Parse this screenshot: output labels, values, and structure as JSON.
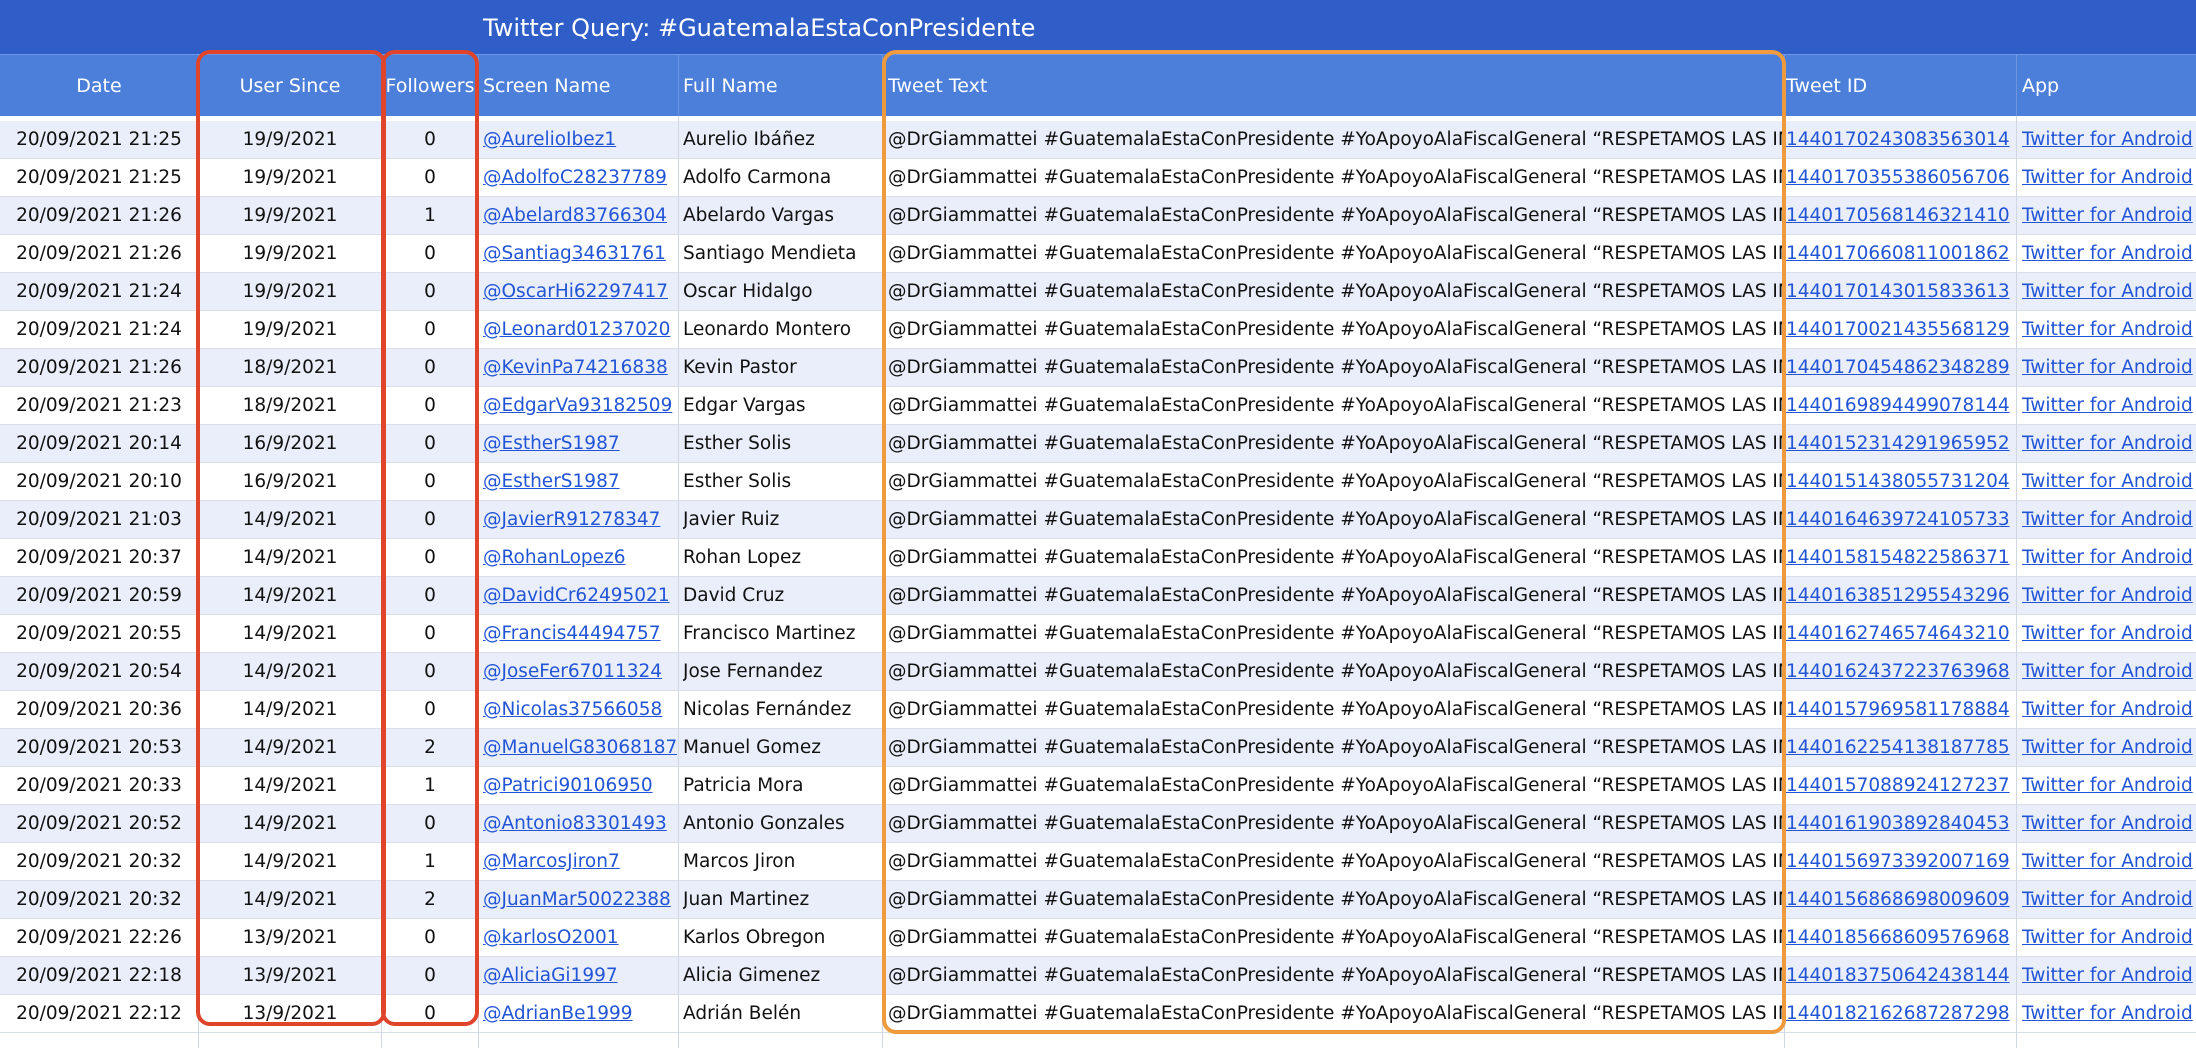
{
  "title": "Twitter Query: #GuatemalaEstaConPresidente",
  "columns": {
    "date": "Date",
    "user_since": "User Since",
    "followers": "Followers",
    "screen_name": "Screen Name",
    "full_name": "Full Name",
    "tweet_text": "Tweet Text",
    "tweet_id": "Tweet ID",
    "app": "App"
  },
  "highlight_colors": {
    "red": "#e0442b",
    "orange": "#ef9a3c"
  },
  "rows": [
    {
      "date": "20/09/2021 21:25",
      "user_since": "19/9/2021",
      "followers": "0",
      "screen_name": "@AurelioIbez1",
      "full_name": "Aurelio Ibáñez",
      "tweet_text": "@DrGiammattei #GuatemalaEstaConPresidente #YoApoyoAlaFiscalGeneral “RESPETAMOS LAS INSTITUC",
      "tweet_id": "1440170243083563014",
      "app": "Twitter for Android"
    },
    {
      "date": "20/09/2021 21:25",
      "user_since": "19/9/2021",
      "followers": "0",
      "screen_name": "@AdolfoC28237789",
      "full_name": "Adolfo Carmona",
      "tweet_text": "@DrGiammattei #GuatemalaEstaConPresidente #YoApoyoAlaFiscalGeneral “RESPETAMOS LAS INSTITUC",
      "tweet_id": "1440170355386056706",
      "app": "Twitter for Android"
    },
    {
      "date": "20/09/2021 21:26",
      "user_since": "19/9/2021",
      "followers": "1",
      "screen_name": "@Abelard83766304",
      "full_name": "Abelardo Vargas",
      "tweet_text": "@DrGiammattei #GuatemalaEstaConPresidente #YoApoyoAlaFiscalGeneral “RESPETAMOS LAS INSTITUC",
      "tweet_id": "1440170568146321410",
      "app": "Twitter for Android"
    },
    {
      "date": "20/09/2021 21:26",
      "user_since": "19/9/2021",
      "followers": "0",
      "screen_name": "@Santiag34631761",
      "full_name": "Santiago Mendieta",
      "tweet_text": "@DrGiammattei #GuatemalaEstaConPresidente #YoApoyoAlaFiscalGeneral “RESPETAMOS LAS INSTITUC",
      "tweet_id": "1440170660811001862",
      "app": "Twitter for Android"
    },
    {
      "date": "20/09/2021 21:24",
      "user_since": "19/9/2021",
      "followers": "0",
      "screen_name": "@OscarHi62297417",
      "full_name": "Oscar Hidalgo",
      "tweet_text": "@DrGiammattei #GuatemalaEstaConPresidente #YoApoyoAlaFiscalGeneral “RESPETAMOS LAS INSTITUC",
      "tweet_id": "1440170143015833613",
      "app": "Twitter for Android"
    },
    {
      "date": "20/09/2021 21:24",
      "user_since": "19/9/2021",
      "followers": "0",
      "screen_name": "@Leonard01237020",
      "full_name": "Leonardo Montero",
      "tweet_text": "@DrGiammattei #GuatemalaEstaConPresidente #YoApoyoAlaFiscalGeneral “RESPETAMOS LAS INSTITUC",
      "tweet_id": "1440170021435568129",
      "app": "Twitter for Android"
    },
    {
      "date": "20/09/2021 21:26",
      "user_since": "18/9/2021",
      "followers": "0",
      "screen_name": "@KevinPa74216838",
      "full_name": "Kevin Pastor",
      "tweet_text": "@DrGiammattei #GuatemalaEstaConPresidente #YoApoyoAlaFiscalGeneral “RESPETAMOS LAS INSTITUC",
      "tweet_id": "1440170454862348289",
      "app": "Twitter for Android"
    },
    {
      "date": "20/09/2021 21:23",
      "user_since": "18/9/2021",
      "followers": "0",
      "screen_name": "@EdgarVa93182509",
      "full_name": "Edgar Vargas",
      "tweet_text": "@DrGiammattei #GuatemalaEstaConPresidente #YoApoyoAlaFiscalGeneral “RESPETAMOS LAS INSTITUC",
      "tweet_id": "1440169894499078144",
      "app": "Twitter for Android"
    },
    {
      "date": "20/09/2021 20:14",
      "user_since": "16/9/2021",
      "followers": "0",
      "screen_name": "@EstherS1987",
      "full_name": "Esther Solis",
      "tweet_text": "@DrGiammattei #GuatemalaEstaConPresidente #YoApoyoAlaFiscalGeneral “RESPETAMOS LAS INSTITUC",
      "tweet_id": "1440152314291965952",
      "app": "Twitter for Android"
    },
    {
      "date": "20/09/2021 20:10",
      "user_since": "16/9/2021",
      "followers": "0",
      "screen_name": "@EstherS1987",
      "full_name": "Esther Solis",
      "tweet_text": "@DrGiammattei #GuatemalaEstaConPresidente #YoApoyoAlaFiscalGeneral “RESPETAMOS LAS INSTITUC",
      "tweet_id": "1440151438055731204",
      "app": "Twitter for Android"
    },
    {
      "date": "20/09/2021 21:03",
      "user_since": "14/9/2021",
      "followers": "0",
      "screen_name": "@JavierR91278347",
      "full_name": "Javier Ruiz",
      "tweet_text": "@DrGiammattei #GuatemalaEstaConPresidente #YoApoyoAlaFiscalGeneral “RESPETAMOS LAS INSTITUC",
      "tweet_id": "1440164639724105733",
      "app": "Twitter for Android"
    },
    {
      "date": "20/09/2021 20:37",
      "user_since": "14/9/2021",
      "followers": "0",
      "screen_name": "@RohanLopez6",
      "full_name": "Rohan Lopez",
      "tweet_text": "@DrGiammattei #GuatemalaEstaConPresidente #YoApoyoAlaFiscalGeneral “RESPETAMOS LAS INSTITUC",
      "tweet_id": "1440158154822586371",
      "app": "Twitter for Android"
    },
    {
      "date": "20/09/2021 20:59",
      "user_since": "14/9/2021",
      "followers": "0",
      "screen_name": "@DavidCr62495021",
      "full_name": "David Cruz",
      "tweet_text": "@DrGiammattei #GuatemalaEstaConPresidente #YoApoyoAlaFiscalGeneral “RESPETAMOS LAS INSTITUC",
      "tweet_id": "1440163851295543296",
      "app": "Twitter for Android"
    },
    {
      "date": "20/09/2021 20:55",
      "user_since": "14/9/2021",
      "followers": "0",
      "screen_name": "@Francis44494757",
      "full_name": "Francisco Martinez",
      "tweet_text": "@DrGiammattei #GuatemalaEstaConPresidente #YoApoyoAlaFiscalGeneral “RESPETAMOS LAS INSTITUC",
      "tweet_id": "1440162746574643210",
      "app": "Twitter for Android"
    },
    {
      "date": "20/09/2021 20:54",
      "user_since": "14/9/2021",
      "followers": "0",
      "screen_name": "@JoseFer67011324",
      "full_name": "Jose Fernandez",
      "tweet_text": "@DrGiammattei #GuatemalaEstaConPresidente #YoApoyoAlaFiscalGeneral “RESPETAMOS LAS INSTITUC",
      "tweet_id": "1440162437223763968",
      "app": "Twitter for Android"
    },
    {
      "date": "20/09/2021 20:36",
      "user_since": "14/9/2021",
      "followers": "0",
      "screen_name": "@Nicolas37566058",
      "full_name": "Nicolas Fernández",
      "tweet_text": "@DrGiammattei #GuatemalaEstaConPresidente #YoApoyoAlaFiscalGeneral “RESPETAMOS LAS INSTITUC",
      "tweet_id": "1440157969581178884",
      "app": "Twitter for Android"
    },
    {
      "date": "20/09/2021 20:53",
      "user_since": "14/9/2021",
      "followers": "2",
      "screen_name": "@ManuelG83068187",
      "full_name": "Manuel Gomez",
      "tweet_text": "@DrGiammattei #GuatemalaEstaConPresidente #YoApoyoAlaFiscalGeneral “RESPETAMOS LAS INSTITUC",
      "tweet_id": "1440162254138187785",
      "app": "Twitter for Android"
    },
    {
      "date": "20/09/2021 20:33",
      "user_since": "14/9/2021",
      "followers": "1",
      "screen_name": "@Patrici90106950",
      "full_name": "Patricia Mora",
      "tweet_text": "@DrGiammattei #GuatemalaEstaConPresidente #YoApoyoAlaFiscalGeneral “RESPETAMOS LAS INSTITUC",
      "tweet_id": "1440157088924127237",
      "app": "Twitter for Android"
    },
    {
      "date": "20/09/2021 20:52",
      "user_since": "14/9/2021",
      "followers": "0",
      "screen_name": "@Antonio83301493",
      "full_name": "Antonio Gonzales",
      "tweet_text": "@DrGiammattei #GuatemalaEstaConPresidente #YoApoyoAlaFiscalGeneral “RESPETAMOS LAS INSTITUC",
      "tweet_id": "1440161903892840453",
      "app": "Twitter for Android"
    },
    {
      "date": "20/09/2021 20:32",
      "user_since": "14/9/2021",
      "followers": "1",
      "screen_name": "@MarcosJiron7",
      "full_name": "Marcos Jiron",
      "tweet_text": "@DrGiammattei #GuatemalaEstaConPresidente #YoApoyoAlaFiscalGeneral “RESPETAMOS LAS INSTITUC",
      "tweet_id": "1440156973392007169",
      "app": "Twitter for Android"
    },
    {
      "date": "20/09/2021 20:32",
      "user_since": "14/9/2021",
      "followers": "2",
      "screen_name": "@JuanMar50022388",
      "full_name": "Juan Martinez",
      "tweet_text": "@DrGiammattei #GuatemalaEstaConPresidente #YoApoyoAlaFiscalGeneral “RESPETAMOS LAS INSTITUC",
      "tweet_id": "1440156868698009609",
      "app": "Twitter for Android"
    },
    {
      "date": "20/09/2021 22:26",
      "user_since": "13/9/2021",
      "followers": "0",
      "screen_name": "@karlosO2001",
      "full_name": "Karlos Obregon",
      "tweet_text": "@DrGiammattei #GuatemalaEstaConPresidente #YoApoyoAlaFiscalGeneral “RESPETAMOS LAS INSTITUC",
      "tweet_id": "1440185668609576968",
      "app": "Twitter for Android"
    },
    {
      "date": "20/09/2021 22:18",
      "user_since": "13/9/2021",
      "followers": "0",
      "screen_name": "@AliciaGi1997",
      "full_name": "Alicia Gimenez",
      "tweet_text": "@DrGiammattei #GuatemalaEstaConPresidente #YoApoyoAlaFiscalGeneral “RESPETAMOS LAS INSTITUC",
      "tweet_id": "1440183750642438144",
      "app": "Twitter for Android"
    },
    {
      "date": "20/09/2021 22:12",
      "user_since": "13/9/2021",
      "followers": "0",
      "screen_name": "@AdrianBe1999",
      "full_name": "Adrián Belén",
      "tweet_text": "@DrGiammattei #GuatemalaEstaConPresidente #YoApoyoAlaFiscalGeneral “RESPETAMOS LAS INSTITUC",
      "tweet_id": "1440182162687287298",
      "app": "Twitter for Android"
    }
  ]
}
